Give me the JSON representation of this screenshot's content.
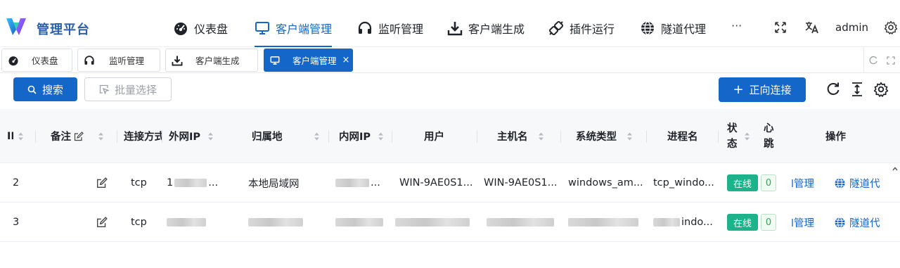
{
  "brand": {
    "title": "管理平台",
    "logo_icon": "v-logo-icon",
    "accent": "#1467c8"
  },
  "nav": {
    "items": [
      {
        "label": "仪表盘",
        "icon": "dashboard-icon"
      },
      {
        "label": "客户端管理",
        "icon": "monitor-icon",
        "active": true
      },
      {
        "label": "监听管理",
        "icon": "headphones-icon"
      },
      {
        "label": "客户端生成",
        "icon": "download-icon"
      },
      {
        "label": "插件运行",
        "icon": "plugin-icon"
      },
      {
        "label": "隧道代理",
        "icon": "globe-icon"
      }
    ],
    "more": "···",
    "user": "admin"
  },
  "tabs": [
    {
      "label": "仪表盘"
    },
    {
      "label": "监听管理"
    },
    {
      "label": "客户端生成"
    },
    {
      "label": "客户端管理",
      "active": true,
      "close": "×"
    }
  ],
  "toolbar": {
    "search_label": "搜索",
    "batch_label": "批量选择",
    "connect_label": "正向连接",
    "connect_plus": "+"
  },
  "table": {
    "columns": {
      "id": "ID",
      "remark": "备注",
      "protocol": "连接方式",
      "external_ip": "外网IP",
      "location": "归属地",
      "internal_ip": "内网IP",
      "user": "用户",
      "hostname": "主机名",
      "os": "系统类型",
      "process": "进程名",
      "status_1": "状",
      "status_2": "态",
      "heartbeat_1": "心",
      "heartbeat_2": "跳",
      "actions": "操作"
    },
    "rows": [
      {
        "id": "2",
        "protocol": "tcp",
        "external_ip": "1",
        "external_ip_tail": "...",
        "location": "本地局域网",
        "internal_ip_tail": "...",
        "user": "WIN-9AE0S1...",
        "hostname": "WIN-9AE0S1...",
        "os": "windows_am...",
        "process": "tcp_windo...",
        "status": "在线",
        "heartbeat": "0",
        "manage": "l管理",
        "tunnel": "隧道代"
      },
      {
        "id": "3",
        "protocol": "tcp",
        "process_tail": "indo...",
        "status": "在线",
        "heartbeat": "0",
        "manage": "l管理",
        "tunnel": "隧道代"
      }
    ]
  },
  "colors": {
    "primary": "#1467c8",
    "online": "#1db38a",
    "header_bg": "#f7f8fa"
  }
}
